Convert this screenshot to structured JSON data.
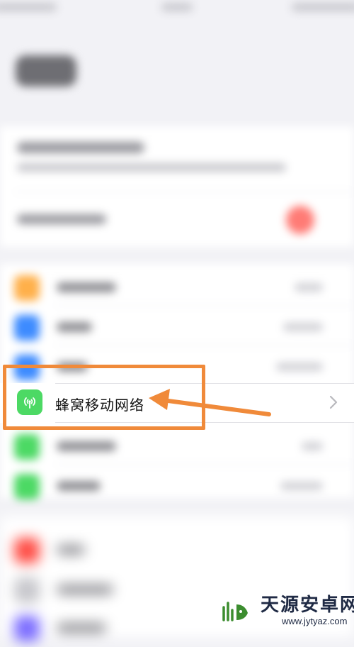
{
  "cellular_row": {
    "label": "蜂窝移动网络",
    "icon": "antenna-icon",
    "icon_color": "#4cd964",
    "chevron": "chevron-right-icon"
  },
  "annotation": {
    "highlight_color": "#f08a3a",
    "arrow": "arrow-left-icon"
  },
  "watermark": {
    "title": "天源安卓网",
    "url": "www.jytyaz.com",
    "color": "#1f2a44"
  }
}
